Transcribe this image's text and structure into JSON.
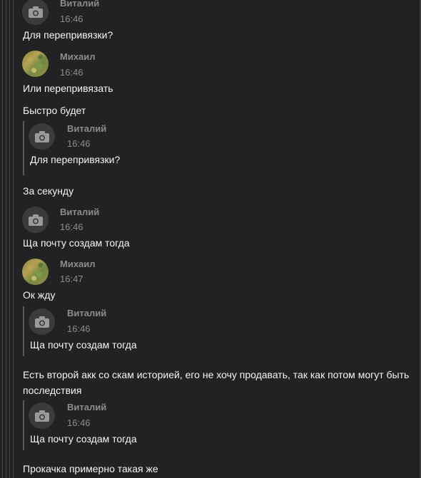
{
  "messages": [
    {
      "author": "Виталий",
      "time": "16:46",
      "text": "Для перепривязки?",
      "avatar": "camera-placeholder"
    },
    {
      "author": "Михаил",
      "time": "16:46",
      "text": "Или перепривязать",
      "avatar": "photo"
    },
    {
      "text": "Быстро будет"
    },
    {
      "quote": {
        "author": "Виталий",
        "time": "16:46",
        "text": "Для перепривязки?"
      }
    },
    {
      "text": "За секунду"
    },
    {
      "author": "Виталий",
      "time": "16:46",
      "text": "Ща почту создам тогда",
      "avatar": "camera-placeholder"
    },
    {
      "author": "Михаил",
      "time": "16:47",
      "text": "Ок жду",
      "avatar": "photo"
    },
    {
      "quote": {
        "author": "Виталий",
        "time": "16:46",
        "text": "Ща почту создам тогда"
      }
    },
    {
      "text": "Есть второй акк со скам историей, его не хочу продавать, так как потом могут быть последствия"
    },
    {
      "quote": {
        "author": "Виталий",
        "time": "16:46",
        "text": "Ща почту создам тогда"
      }
    },
    {
      "text": "Прокачка примерно такая же"
    }
  ],
  "colors": {
    "background": "#222224",
    "text": "#f4f4f4",
    "meta": "#8c8c8e",
    "line": "#4a4a4c"
  },
  "icons": {
    "camera-placeholder": "camera-icon"
  }
}
